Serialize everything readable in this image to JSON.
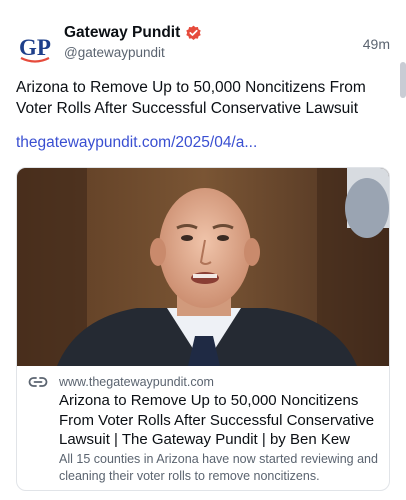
{
  "post": {
    "author_name": "Gateway Pundit",
    "author_handle": "@gatewaypundit",
    "avatar_initials": "GP",
    "verified_badge_icon": "verified-badge-icon",
    "timestamp": "49m",
    "text": "Arizona to Remove Up to 50,000 Noncitizens From Voter Rolls After Successful Conservative Lawsuit",
    "link_text": "thegatewaypundit.com/2025/04/a..."
  },
  "link_card": {
    "image_icon": "man-portrait-photo",
    "link_icon": "link-chain-icon",
    "domain": "www.thegatewaypundit.com",
    "title": "Arizona to Remove Up to 50,000 Noncitizens From Voter Rolls After Successful Conservative Lawsuit | The Gateway Pundit | by Ben Kew",
    "description": "All 15 counties in Arizona have now started reviewing and cleaning their voter rolls to remove noncitizens."
  },
  "colors": {
    "accent": "#3a4fd1",
    "avatar_blue": "#1e3f8a",
    "badge_red": "#e64b3c",
    "muted_text": "#5b6470"
  }
}
